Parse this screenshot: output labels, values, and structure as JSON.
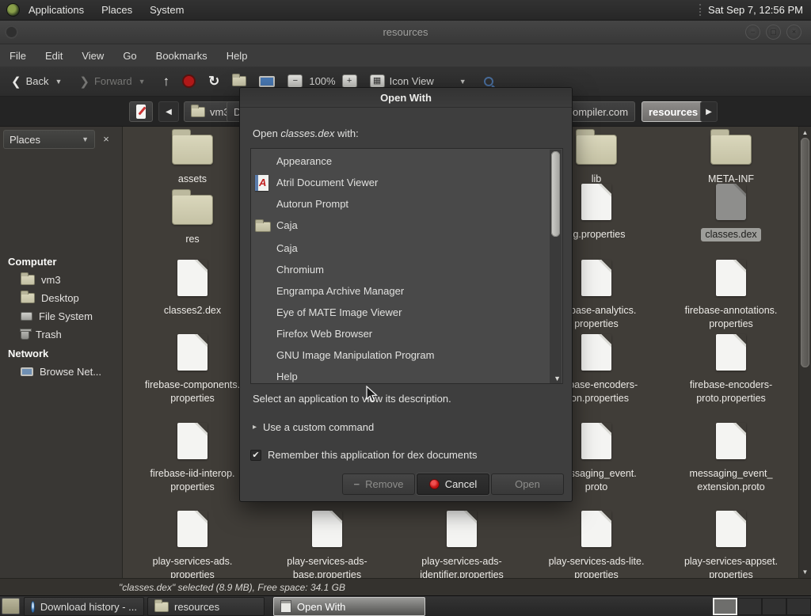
{
  "panel": {
    "menus": [
      "Applications",
      "Places",
      "System"
    ],
    "clock": "Sat Sep 7, 12:56 PM"
  },
  "titlebar": {
    "title": "resources"
  },
  "menubar": {
    "items": [
      "File",
      "Edit",
      "View",
      "Go",
      "Bookmarks",
      "Help"
    ]
  },
  "toolbar": {
    "back": "Back",
    "forward": "Forward",
    "zoom_out": "−",
    "zoom_level": "100%",
    "zoom_in": "+",
    "view_mode": "Icon View"
  },
  "locationbar": {
    "crumb_home": "vm3",
    "crumb_hidden": "De",
    "crumb_compiler": "ompiler.com",
    "crumb_current": "resources"
  },
  "sidebar": {
    "header": "Places",
    "close": "×",
    "section_computer": "Computer",
    "computer_items": [
      "vm3",
      "Desktop",
      "File System",
      "Trash"
    ],
    "section_network": "Network",
    "network_items": [
      "Browse Net..."
    ]
  },
  "files": [
    {
      "l1": "assets",
      "l2": ""
    },
    {
      "l1": "lib",
      "l2": ""
    },
    {
      "l1": "META-INF",
      "l2": ""
    },
    {
      "l1": "res",
      "l2": ""
    },
    {
      "l1": "ng.properties",
      "l2": ""
    },
    {
      "l1": "classes.dex",
      "l2": ""
    },
    {
      "l1": "classes2.dex",
      "l2": ""
    },
    {
      "l1": "firebase-analytics.",
      "l2": "properties"
    },
    {
      "l1": "firebase-annotations.",
      "l2": "properties"
    },
    {
      "l1": "firebase-components.",
      "l2": "properties"
    },
    {
      "l1": "firebase-encoders-",
      "l2": "json.properties"
    },
    {
      "l1": "firebase-encoders-",
      "l2": "proto.properties"
    },
    {
      "l1": "firebase-iid-interop.",
      "l2": "properties"
    },
    {
      "l1": "messaging_event.",
      "l2": "proto"
    },
    {
      "l1": "messaging_event_",
      "l2": "extension.proto"
    },
    {
      "l1": "play-services-ads.",
      "l2": "properties"
    },
    {
      "l1": "play-services-ads-",
      "l2": "base.properties"
    },
    {
      "l1": "play-services-ads-",
      "l2": "identifier.properties"
    },
    {
      "l1": "play-services-ads-lite.",
      "l2": "properties"
    },
    {
      "l1": "play-services-appset.",
      "l2": "properties"
    }
  ],
  "dialog": {
    "title": "Open With",
    "prompt_open": "Open ",
    "prompt_file": "classes.dex",
    "prompt_with": " with:",
    "apps": [
      "Appearance",
      "Atril Document Viewer",
      "Autorun Prompt",
      "Caja",
      "Caja",
      "Chromium",
      "Engrampa Archive Manager",
      "Eye of MATE Image Viewer",
      "Firefox Web Browser",
      "GNU Image Manipulation Program",
      "Help"
    ],
    "hint": "Select an application to view its description.",
    "expander_label": "Use a custom command",
    "checkbox_glyph": "✔",
    "checkbox_label": "Remember this application for dex documents",
    "remove_label": "Remove",
    "cancel_label": "Cancel",
    "open_label": "Open"
  },
  "statusbar": {
    "text": "\"classes.dex\" selected (8.9 MB), Free space: 34.1 GB"
  },
  "taskbar": {
    "win_browser": "Download history - ...",
    "win_files": "resources",
    "win_dialog": "Open With"
  }
}
